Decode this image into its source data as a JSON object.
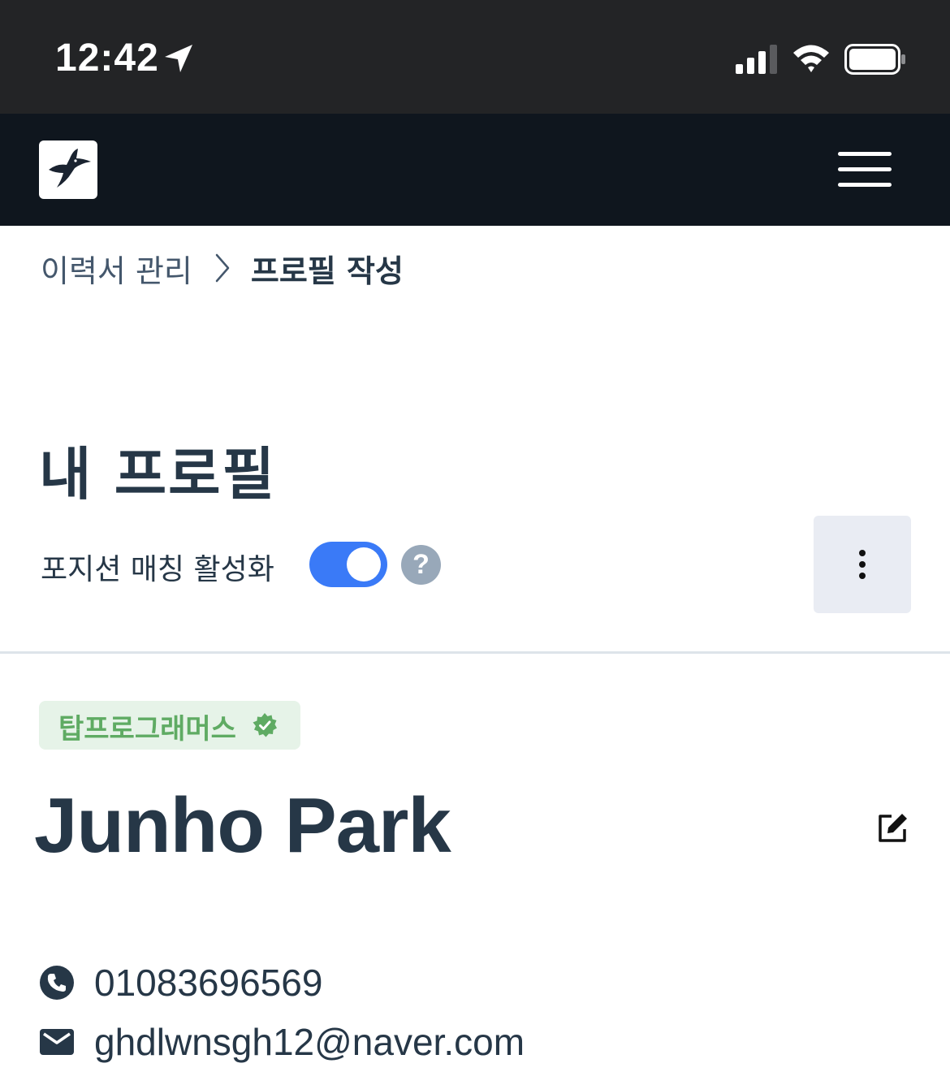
{
  "status_bar": {
    "time": "12:42",
    "icons": [
      "location-arrow-icon",
      "cellular-signal-icon",
      "wifi-icon",
      "battery-icon"
    ]
  },
  "header": {
    "logo": "hummingbird-logo",
    "menu_icon": "hamburger-menu-icon"
  },
  "breadcrumb": {
    "parent": "이력서 관리",
    "separator_icon": "chevron-right-icon",
    "current": "프로필 작성"
  },
  "page": {
    "title": "내 프로필"
  },
  "matching": {
    "label": "포지션 매칭 활성화",
    "enabled": true,
    "help_icon": "question-icon",
    "help_glyph": "?",
    "more_icon": "more-vertical-icon"
  },
  "profile": {
    "badge": "탑프로그래머스",
    "badge_icon": "verified-badge-icon",
    "name": "Junho Park",
    "edit_icon": "edit-icon",
    "phone": "01083696569",
    "email": "ghdlwnsgh12@naver.com"
  },
  "colors": {
    "status_bar": "#232426",
    "header": "#0f161e",
    "text": "#263747",
    "toggle_on": "#3a7af7",
    "badge_bg": "#e6f3e8",
    "badge_text": "#5fab63",
    "more_btn_bg": "#e9ecf3"
  }
}
